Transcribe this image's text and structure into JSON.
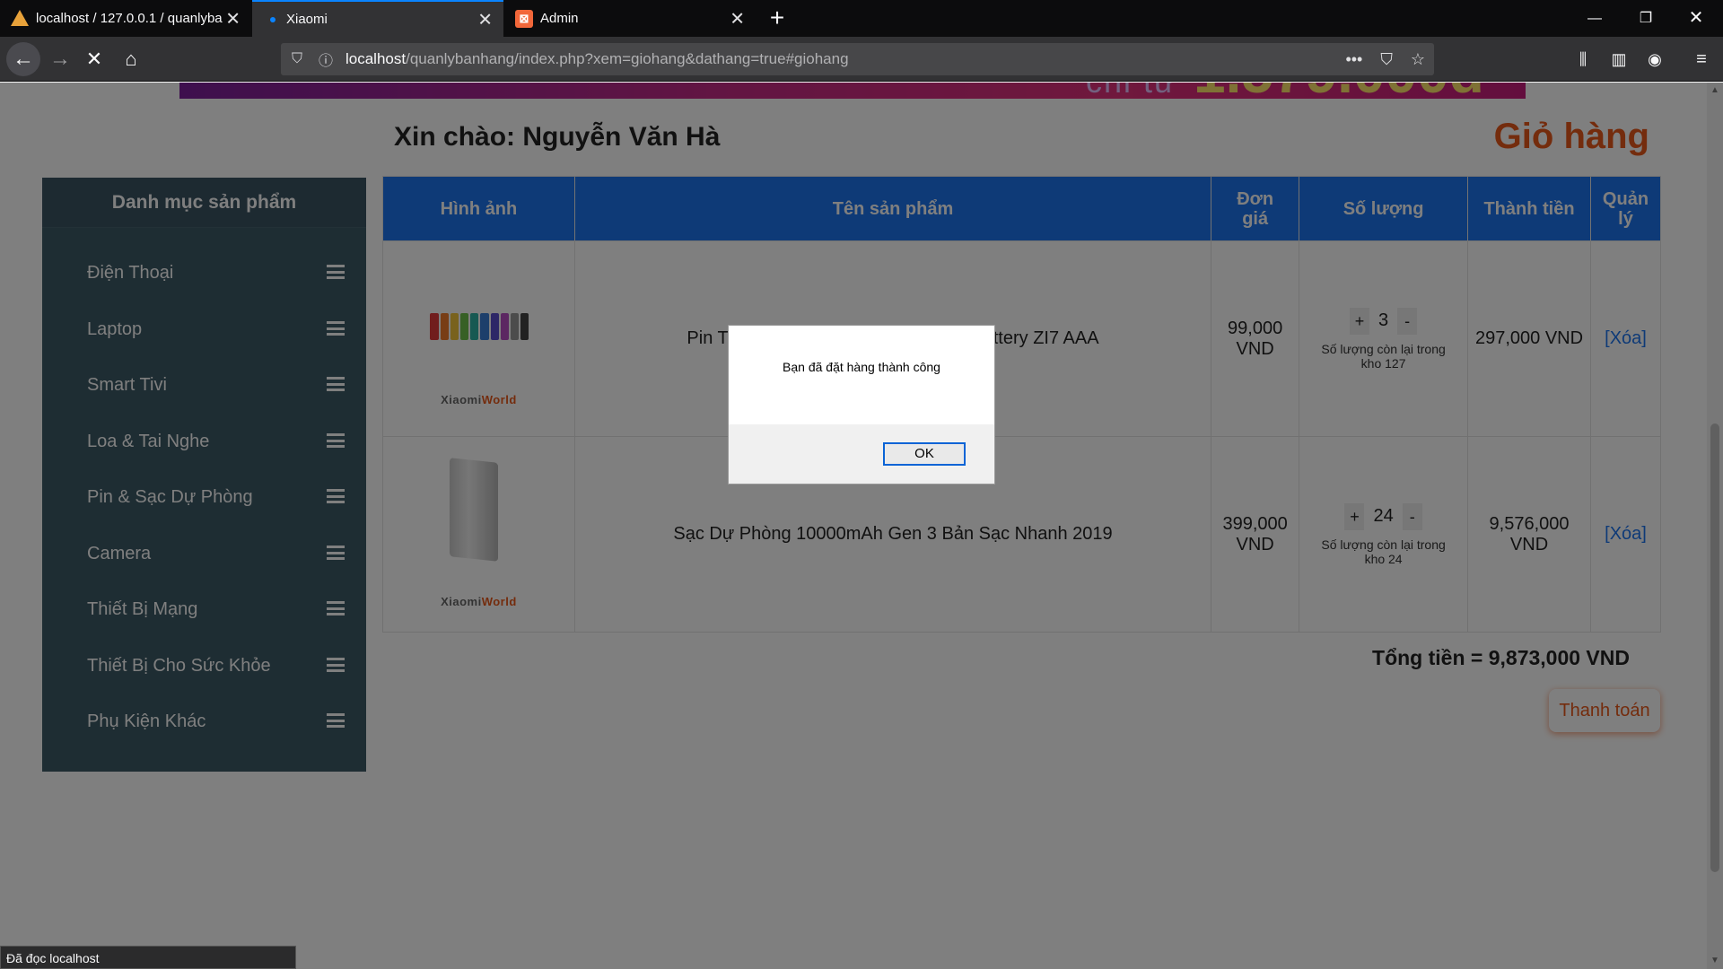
{
  "browser": {
    "tabs": [
      {
        "title": "localhost / 127.0.0.1 / quanlyba",
        "icon": "phpmyadmin-icon"
      },
      {
        "title": "Xiaomi",
        "icon": "loading-dot-icon"
      },
      {
        "title": "Admin",
        "icon": "xampp-icon"
      }
    ],
    "new_tab_label": "+",
    "url_host": "localhost",
    "url_rest": "/quanlybanhang/index.php?xem=giohang&dathang=true#giohang",
    "status_text": "Đã đọc localhost"
  },
  "header": {
    "greeting": "Xin chào: Nguyễn Văn Hà",
    "cart_title": "Giỏ hàng"
  },
  "sidebar": {
    "title": "Danh mục sản phẩm",
    "items": [
      {
        "label": "Điện Thoại"
      },
      {
        "label": "Laptop"
      },
      {
        "label": "Smart Tivi"
      },
      {
        "label": "Loa & Tai Nghe"
      },
      {
        "label": "Pin & Sạc Dự Phòng"
      },
      {
        "label": "Camera"
      },
      {
        "label": "Thiết Bị Mạng"
      },
      {
        "label": "Thiết Bị Cho Sức Khỏe"
      },
      {
        "label": "Phụ Kiện Khác"
      }
    ]
  },
  "cart": {
    "headers": {
      "image": "Hình ảnh",
      "name": "Tên sản phẩm",
      "unit_price": "Đơn giá",
      "quantity": "Số lượng",
      "subtotal": "Thành tiền",
      "manage": "Quản lý"
    },
    "rows": [
      {
        "brand_prefix": "Xiaomi",
        "brand_suffix": "World",
        "name_left": "Pin T",
        "name_right": "ttery ZI7 AAA",
        "unit_price": "99,000 VND",
        "qty": "3",
        "plus": "+",
        "minus": "-",
        "stock": "Số lượng còn lại trong kho 127",
        "subtotal": "297,000 VND",
        "delete": "[Xóa]"
      },
      {
        "brand_prefix": "Xiaomi",
        "brand_suffix": "World",
        "name": "Sạc Dự Phòng 10000mAh Gen 3 Bản Sạc Nhanh 2019",
        "unit_price": "399,000 VND",
        "qty": "24",
        "plus": "+",
        "minus": "-",
        "stock": "Số lượng còn lại trong kho 24",
        "subtotal": "9,576,000 VND",
        "delete": "[Xóa]"
      }
    ],
    "total": "Tổng tiền = 9,873,000 VND",
    "pay_button": "Thanh toán"
  },
  "banner": {
    "text_small": "chỉ từ",
    "text_big": "1.579.000đ"
  },
  "dialog": {
    "message": "Bạn đã đặt hàng thành công",
    "ok_label": "OK"
  },
  "colors": {
    "accent_orange": "#e8581a",
    "table_header_blue": "#1c74ef",
    "sidebar_bg": "#3d5a66"
  }
}
